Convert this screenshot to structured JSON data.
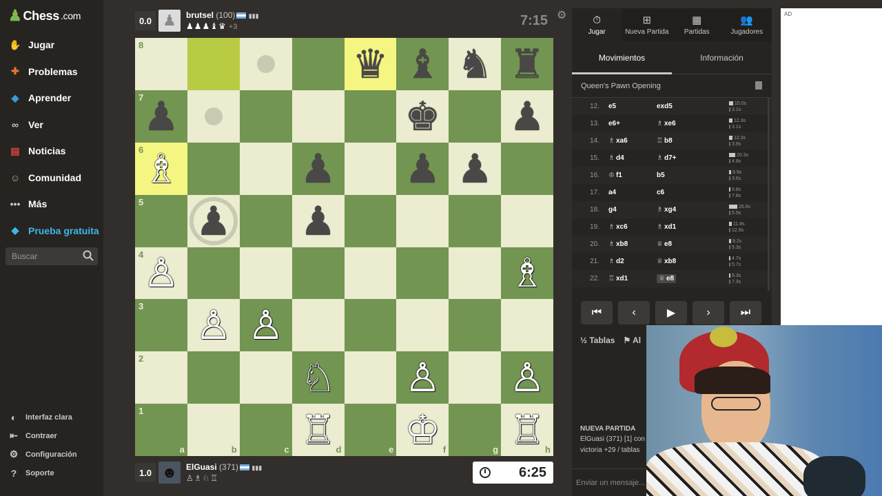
{
  "brand": {
    "name": "Chess",
    "tld": ".com"
  },
  "sidebar": {
    "items": [
      {
        "label": "Jugar",
        "icon": "play-hand-icon",
        "color": "#ec6b45"
      },
      {
        "label": "Problemas",
        "icon": "puzzle-icon",
        "color": "#e8742f"
      },
      {
        "label": "Aprender",
        "icon": "learn-icon",
        "color": "#3b9ad9"
      },
      {
        "label": "Ver",
        "icon": "binoculars-icon",
        "color": "#c9c8c6"
      },
      {
        "label": "Noticias",
        "icon": "news-icon",
        "color": "#d9453d"
      },
      {
        "label": "Comunidad",
        "icon": "community-icon",
        "color": "#bfa78a"
      },
      {
        "label": "Más",
        "icon": "more-dots-icon",
        "color": "#c9c8c6"
      },
      {
        "label": "Prueba gratuita",
        "icon": "diamond-icon",
        "color": "#3db7e8"
      }
    ],
    "search_placeholder": "Buscar",
    "bottom": [
      {
        "label": "Interfaz clara",
        "icon": "contrast-icon"
      },
      {
        "label": "Contraer",
        "icon": "collapse-icon"
      },
      {
        "label": "Configuración",
        "icon": "settings-icon"
      },
      {
        "label": "Soporte",
        "icon": "help-icon"
      }
    ]
  },
  "top_player": {
    "score": "0.0",
    "name": "brutsel",
    "rating": "(100)",
    "captured": "♟♟♟♝♛",
    "plus": "+3",
    "clock": "7:15"
  },
  "bottom_player": {
    "score": "1.0",
    "name": "ElGuasi",
    "rating": "(371)",
    "captured": "♙♗♘♖",
    "clock": "6:25"
  },
  "board": {
    "ranks": [
      "8",
      "7",
      "6",
      "5",
      "4",
      "3",
      "2",
      "1"
    ],
    "files": [
      "a",
      "b",
      "c",
      "d",
      "e",
      "f",
      "g",
      "h"
    ],
    "highlight": [
      "b8",
      "e8",
      "a6"
    ],
    "hints": [
      "c8",
      "b7"
    ],
    "ring": [
      "b5"
    ],
    "pieces": {
      "e8": "♛",
      "f8": "♝",
      "g8": "♞",
      "h8": "♜",
      "a7": "♟",
      "f7": "♚",
      "h7": "♟",
      "a6": "♗",
      "d6": "♟",
      "f6": "♟",
      "g6": "♟",
      "b5": "♟",
      "d5": "♟",
      "a4": "♙",
      "h4": "♗",
      "b3": "♙",
      "c3": "♙",
      "d2": "♘",
      "f2": "♙",
      "h2": "♙",
      "d1": "♖",
      "f1": "♔",
      "h1": "♖"
    },
    "white_pieces": [
      "a6",
      "a4",
      "h4",
      "b3",
      "c3",
      "d2",
      "f2",
      "h2",
      "d1",
      "f1",
      "h1"
    ]
  },
  "panel": {
    "tabs": [
      {
        "label": "Jugar",
        "icon": "clock-icon"
      },
      {
        "label": "Nueva Partida",
        "icon": "plus-icon"
      },
      {
        "label": "Partidas",
        "icon": "board-icon"
      },
      {
        "label": "Jugadores",
        "icon": "players-icon"
      }
    ],
    "subtabs": [
      "Movimientos",
      "Información"
    ],
    "opening": "Queen's Pawn Opening",
    "moves": [
      {
        "n": "12.",
        "w": "e5",
        "wf": "",
        "b": "exd5",
        "bf": "",
        "tw": "15.0s",
        "tb": "3.1s",
        "bar": 6
      },
      {
        "n": "13.",
        "w": "e6+",
        "wf": "",
        "b": "xe6",
        "bf": "♗",
        "tw": "12.3s",
        "tb": "3.1s",
        "bar": 5
      },
      {
        "n": "14.",
        "w": "xa6",
        "wf": "♗",
        "b": "b8",
        "bf": "♖",
        "tw": "12.3s",
        "tb": "3.9s",
        "bar": 5
      },
      {
        "n": "15.",
        "w": "d4",
        "wf": "♗",
        "b": "d7+",
        "bf": "♗",
        "tw": "20.3s",
        "tb": "4.8s",
        "bar": 9
      },
      {
        "n": "16.",
        "w": "f1",
        "wf": "♔",
        "b": "b5",
        "bf": "",
        "tw": "9.9s",
        "tb": "3.6s",
        "bar": 3
      },
      {
        "n": "17.",
        "w": "a4",
        "wf": "",
        "b": "c6",
        "bf": "",
        "tw": "5.8s",
        "tb": "7.8s",
        "bar": 2
      },
      {
        "n": "18.",
        "w": "g4",
        "wf": "",
        "b": "xg4",
        "bf": "♗",
        "tw": "26.6s",
        "tb": "5.5s",
        "bar": 12
      },
      {
        "n": "19.",
        "w": "xc6",
        "wf": "♗",
        "b": "xd1",
        "bf": "♗",
        "tw": "11.8s",
        "tb": "12.9s",
        "bar": 4
      },
      {
        "n": "20.",
        "w": "xb8",
        "wf": "♗",
        "b": "e8",
        "bf": "♕",
        "tw": "9.2s",
        "tb": "5.3s",
        "bar": 3
      },
      {
        "n": "21.",
        "w": "d2",
        "wf": "♗",
        "b": "xb8",
        "bf": "♕",
        "tw": "4.7s",
        "tb": "5.7s",
        "bar": 2
      },
      {
        "n": "22.",
        "w": "xd1",
        "wf": "♖",
        "b": "e8",
        "bf": "♕",
        "tw": "5.3s",
        "tb": "7.3s",
        "bar": 2
      }
    ],
    "controls": [
      "⏮",
      "‹",
      "▶",
      "›",
      "⏭"
    ],
    "actions": {
      "draw": "Tablas",
      "abort": "Al"
    },
    "chat": {
      "title": "NUEVA PARTIDA",
      "line1": "ElGuasi (371) [1] con",
      "line2": "victoria +29 / tablas",
      "placeholder": "Enviar un mensaje..."
    }
  },
  "ad": {
    "label": "AD"
  }
}
